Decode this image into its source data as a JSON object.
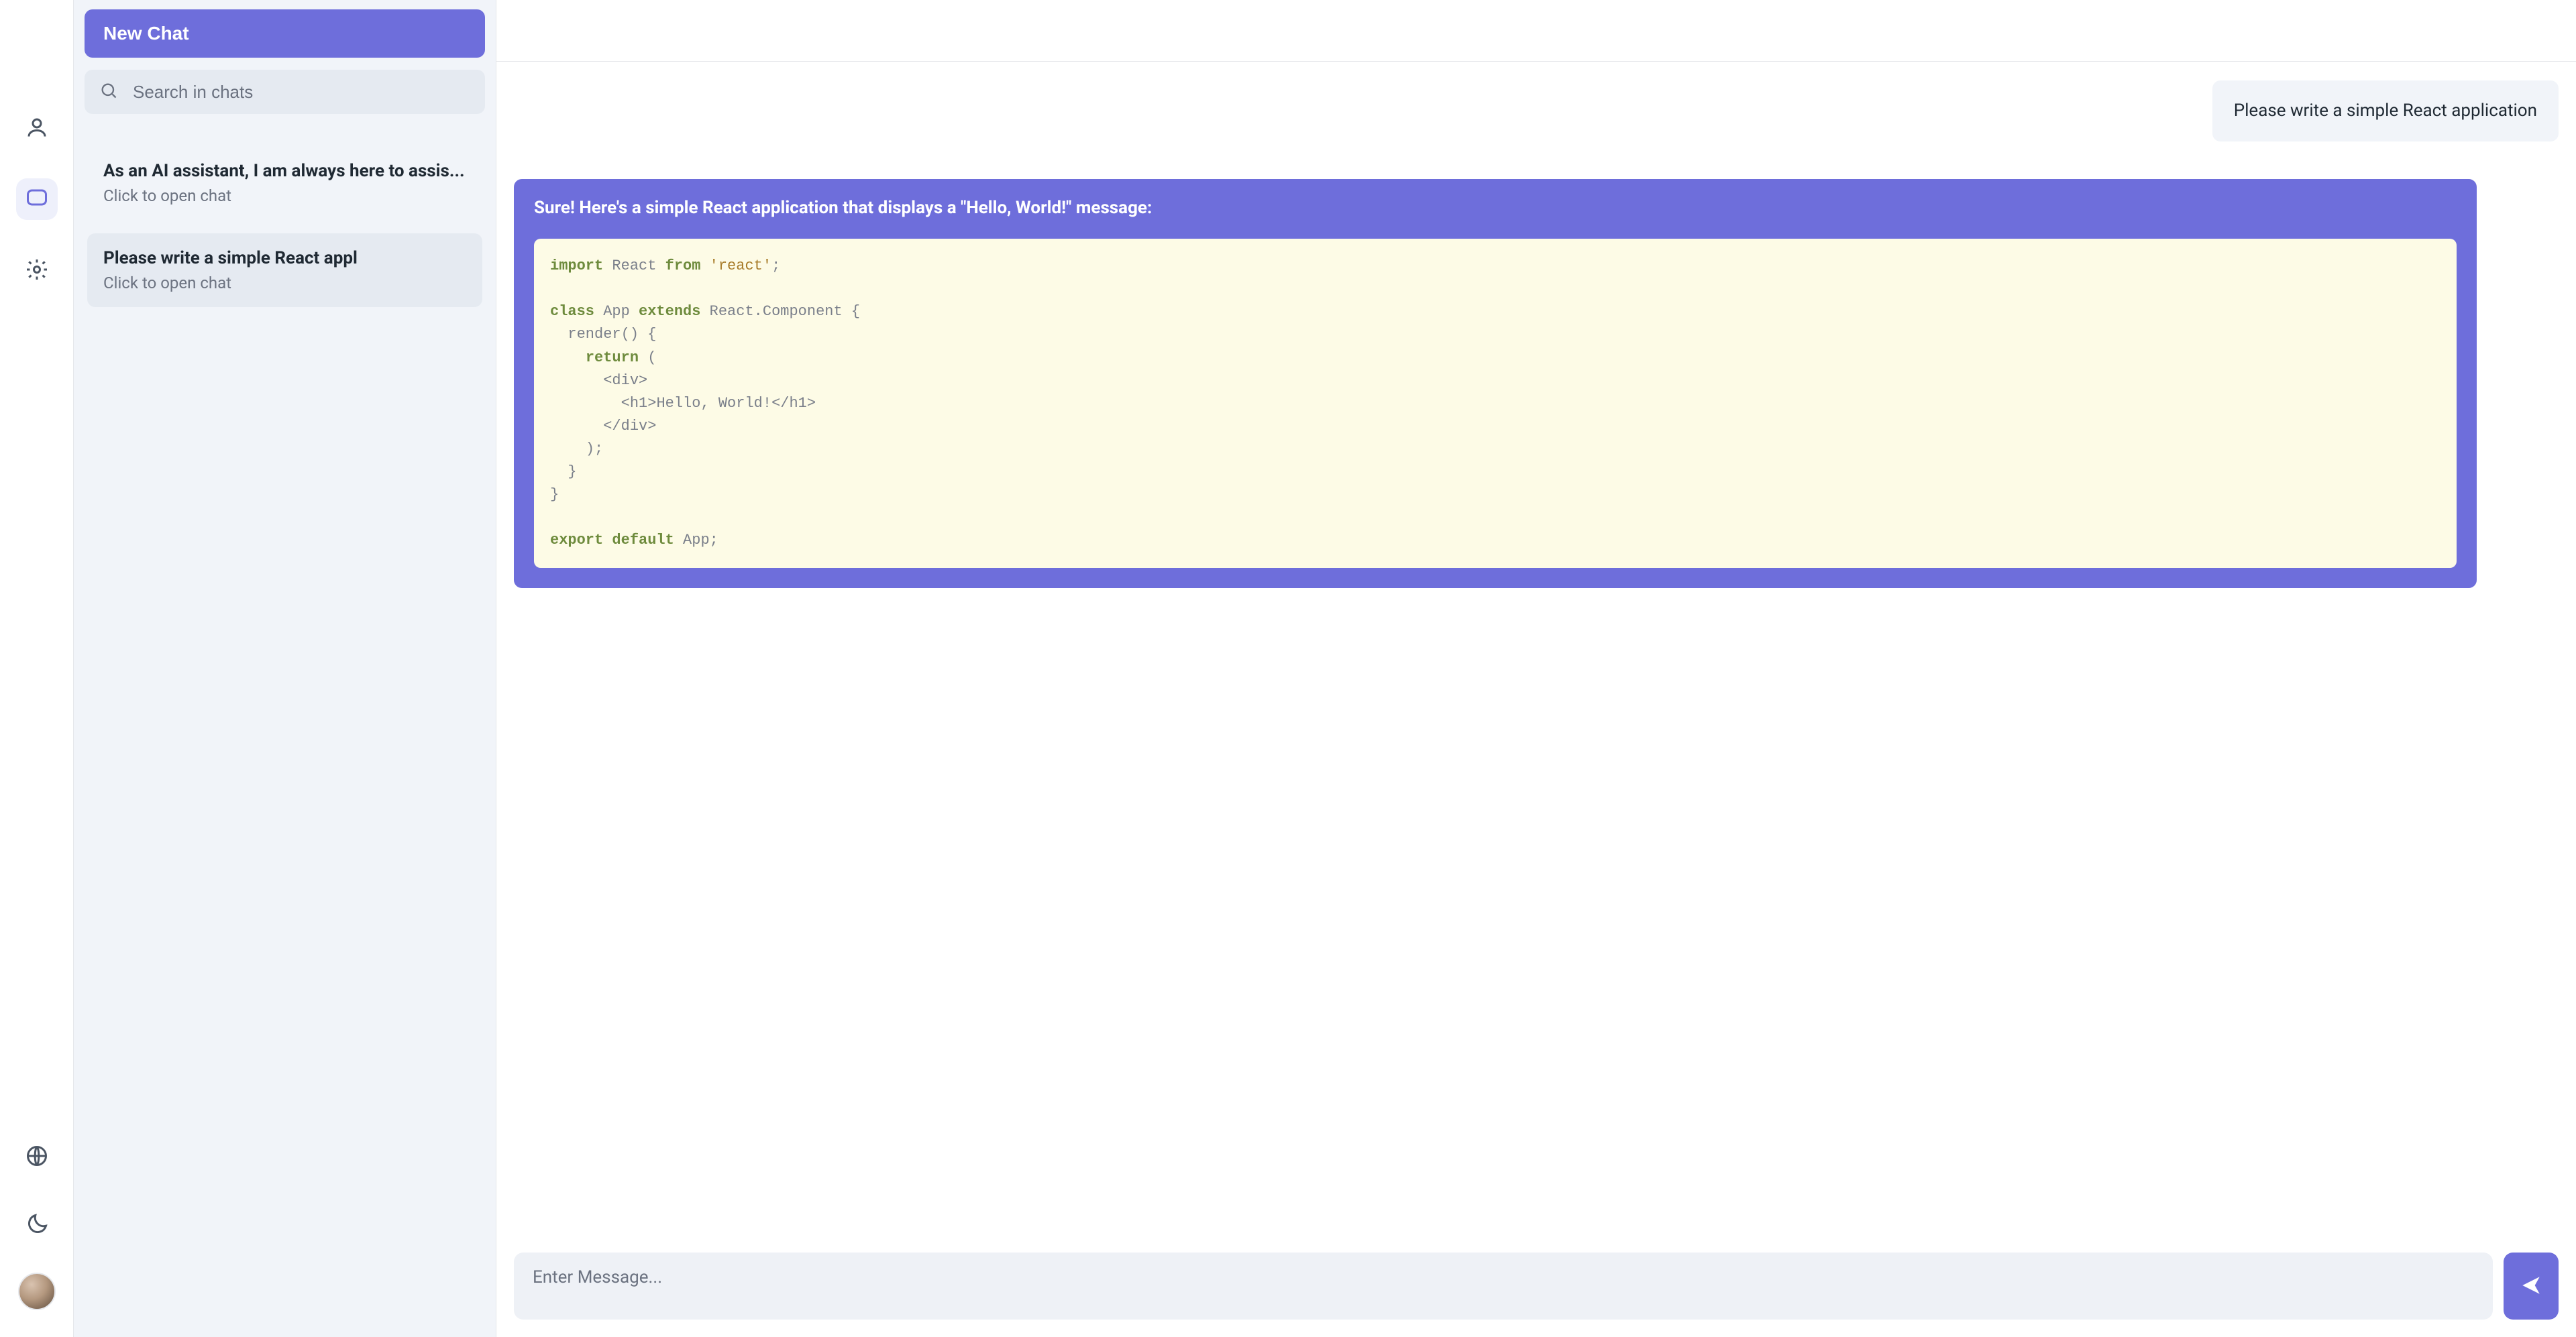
{
  "sidebar_rail": {
    "icons": {
      "profile": "profile-icon",
      "chat": "chat-bubble-icon",
      "settings": "gear-icon",
      "globe": "globe-icon",
      "dark_mode": "moon-icon",
      "avatar": "user-avatar"
    }
  },
  "sidebar": {
    "new_chat_label": "New Chat",
    "search_placeholder": "Search in chats",
    "chats": [
      {
        "title": "As an AI assistant, I am always here to assis...",
        "subtitle": "Click to open chat",
        "selected": false
      },
      {
        "title": "Please write a simple React appl",
        "subtitle": "Click to open chat",
        "selected": true
      }
    ]
  },
  "conversation": {
    "user_message": "Please write a simple React application",
    "assistant_intro": "Sure! Here's a simple React application that displays a \"Hello, World!\" message:",
    "code_tokens": [
      [
        {
          "t": "kw",
          "v": "import"
        },
        {
          "t": "sp",
          "v": " "
        },
        {
          "t": "ident",
          "v": "React"
        },
        {
          "t": "sp",
          "v": " "
        },
        {
          "t": "kw",
          "v": "from"
        },
        {
          "t": "sp",
          "v": " "
        },
        {
          "t": "str",
          "v": "'react'"
        },
        {
          "t": "punc",
          "v": ";"
        }
      ],
      [],
      [
        {
          "t": "kw",
          "v": "class"
        },
        {
          "t": "sp",
          "v": " "
        },
        {
          "t": "ident",
          "v": "App"
        },
        {
          "t": "sp",
          "v": " "
        },
        {
          "t": "kw",
          "v": "extends"
        },
        {
          "t": "sp",
          "v": " "
        },
        {
          "t": "ident",
          "v": "React"
        },
        {
          "t": "punc",
          "v": "."
        },
        {
          "t": "ident",
          "v": "Component"
        },
        {
          "t": "sp",
          "v": " "
        },
        {
          "t": "punc",
          "v": "{"
        }
      ],
      [
        {
          "t": "sp",
          "v": "  "
        },
        {
          "t": "ident",
          "v": "render"
        },
        {
          "t": "punc",
          "v": "()"
        },
        {
          "t": "sp",
          "v": " "
        },
        {
          "t": "punc",
          "v": "{"
        }
      ],
      [
        {
          "t": "sp",
          "v": "    "
        },
        {
          "t": "kw",
          "v": "return"
        },
        {
          "t": "sp",
          "v": " "
        },
        {
          "t": "punc",
          "v": "("
        }
      ],
      [
        {
          "t": "sp",
          "v": "      "
        },
        {
          "t": "tag",
          "v": "<div>"
        }
      ],
      [
        {
          "t": "sp",
          "v": "        "
        },
        {
          "t": "tag",
          "v": "<h1>"
        },
        {
          "t": "text",
          "v": "Hello, World!"
        },
        {
          "t": "tag",
          "v": "</h1>"
        }
      ],
      [
        {
          "t": "sp",
          "v": "      "
        },
        {
          "t": "tag",
          "v": "</div>"
        }
      ],
      [
        {
          "t": "sp",
          "v": "    "
        },
        {
          "t": "punc",
          "v": ");"
        }
      ],
      [
        {
          "t": "sp",
          "v": "  "
        },
        {
          "t": "punc",
          "v": "}"
        }
      ],
      [
        {
          "t": "punc",
          "v": "}"
        }
      ],
      [],
      [
        {
          "t": "kw",
          "v": "export"
        },
        {
          "t": "sp",
          "v": " "
        },
        {
          "t": "kw",
          "v": "default"
        },
        {
          "t": "sp",
          "v": " "
        },
        {
          "t": "ident",
          "v": "App"
        },
        {
          "t": "punc",
          "v": ";"
        }
      ]
    ]
  },
  "composer": {
    "placeholder": "Enter Message..."
  },
  "colors": {
    "accent": "#6e6edb",
    "sidebar_bg": "#f1f4f9",
    "code_bg": "#fdfbe6"
  }
}
